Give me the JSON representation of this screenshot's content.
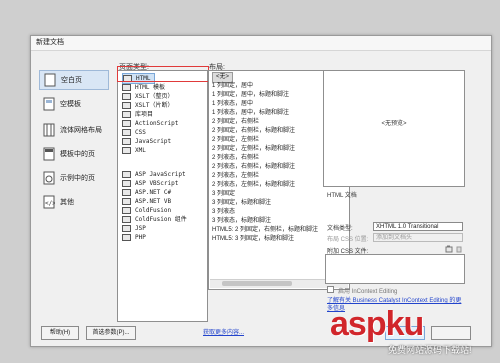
{
  "dialog": {
    "title": "新建文档"
  },
  "categories": [
    {
      "label": "空白页",
      "icon": "blank-page-icon"
    },
    {
      "label": "空模板",
      "icon": "blank-template-icon"
    },
    {
      "label": "流体网格布局",
      "icon": "fluid-grid-icon"
    },
    {
      "label": "模板中的页",
      "icon": "template-page-icon"
    },
    {
      "label": "示例中的页",
      "icon": "sample-page-icon"
    },
    {
      "label": "其他",
      "icon": "other-icon"
    }
  ],
  "page_type": {
    "label": "页面类型:",
    "items": [
      "HTML",
      "HTML 模板",
      "XSLT（整页）",
      "XSLT（片断）",
      "库项目",
      "ActionScript",
      "CSS",
      "JavaScript",
      "XML"
    ],
    "items2": [
      "ASP JavaScript",
      "ASP VBScript",
      "ASP.NET C#",
      "ASP.NET VB",
      "ColdFusion",
      "ColdFusion 组件",
      "JSP",
      "PHP"
    ],
    "selected": "HTML"
  },
  "layout": {
    "label": "布局:",
    "items": [
      "<无>",
      "1 列固定，居中",
      "1 列固定，居中，标题和脚注",
      "1 列液态，居中",
      "1 列液态，居中，标题和脚注",
      "2 列固定，右侧栏",
      "2 列固定，右侧栏，标题和脚注",
      "2 列固定，左侧栏",
      "2 列固定，左侧栏，标题和脚注",
      "2 列液态，右侧栏",
      "2 列液态，右侧栏，标题和脚注",
      "2 列液态，左侧栏",
      "2 列液态，左侧栏，标题和脚注",
      "3 列固定",
      "3 列固定，标题和脚注",
      "3 列液态",
      "3 列液态，标题和脚注",
      "HTML5: 2 列固定，右侧栏，标题和脚注",
      "HTML5: 3 列固定，标题和脚注"
    ],
    "selected": "<无>"
  },
  "preview": {
    "text": "<无预览>",
    "description": "HTML 文档"
  },
  "doc_type": {
    "label": "文档类型:",
    "value": "XHTML 1.0 Transitional"
  },
  "css_position": {
    "label": "布局 CSS 位置:",
    "value": "添加到文档头"
  },
  "attach_css": {
    "label": "附加 CSS 文件:"
  },
  "incontext": {
    "label": "启用 InContext Editing"
  },
  "link_text": "了解有关 Business Catalyst InContext Editing 的更多信息",
  "buttons": {
    "help": "帮助(H)",
    "prefs": "首选参数(P)...",
    "more": "获取更多内容..."
  },
  "watermark": {
    "main": "aspku",
    "sub": "免费网站源码下载站!"
  }
}
